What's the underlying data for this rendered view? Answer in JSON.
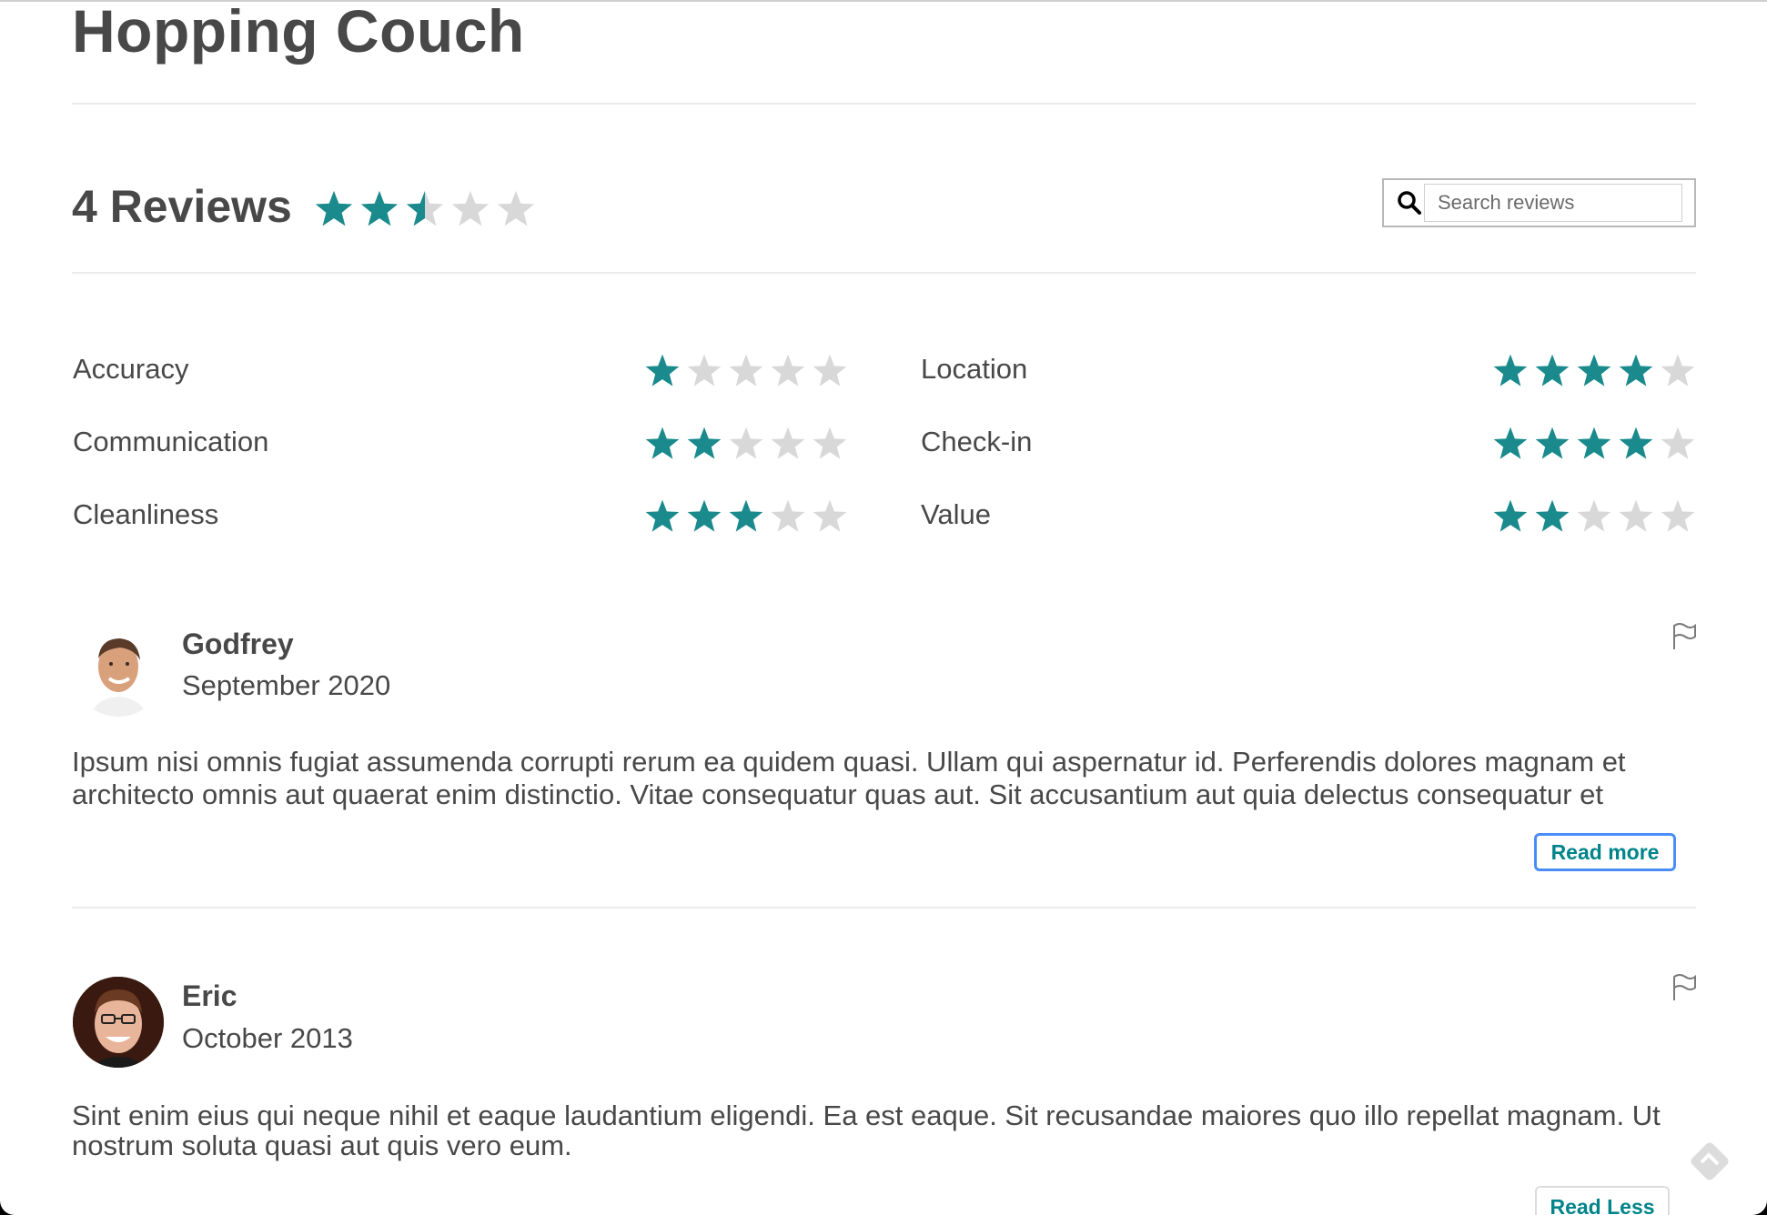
{
  "listing": {
    "title": "Hopping Couch"
  },
  "summary": {
    "reviews_label": "4 Reviews",
    "overall_rating": 2.5,
    "max_rating": 5
  },
  "search": {
    "placeholder": "Search reviews"
  },
  "categories": [
    {
      "label": "Accuracy",
      "rating": 1
    },
    {
      "label": "Communication",
      "rating": 2
    },
    {
      "label": "Cleanliness",
      "rating": 3
    },
    {
      "label": "Location",
      "rating": 4
    },
    {
      "label": "Check-in",
      "rating": 4
    },
    {
      "label": "Value",
      "rating": 2
    }
  ],
  "reviews": [
    {
      "name": "Godfrey",
      "date": "September 2020",
      "text": "Ipsum nisi omnis fugiat assumenda corrupti rerum ea quidem quasi. Ullam qui aspernatur id. Perferendis dolores magnam et architecto omnis aut quaerat enim distinctio. Vitae consequatur quas aut. Sit accusantium aut quia delectus consequatur et",
      "button": "Read more"
    },
    {
      "name": "Eric",
      "date": "October 2013",
      "text": "Sint enim eius qui neque nihil et eaque laudantium eligendi. Ea est eaque. Sit recusandae maiores quo illo repellat magnam. Ut nostrum soluta quasi aut quis vero eum.",
      "button": "Read Less"
    }
  ],
  "icons": {
    "star": "star-icon",
    "search": "search-icon",
    "flag": "flag-icon"
  },
  "colors": {
    "accent": "#00848a",
    "star_filled": "#1a8a8c",
    "star_empty": "#d8d8d8",
    "text": "#484848",
    "focus_ring": "#4b8df8"
  }
}
